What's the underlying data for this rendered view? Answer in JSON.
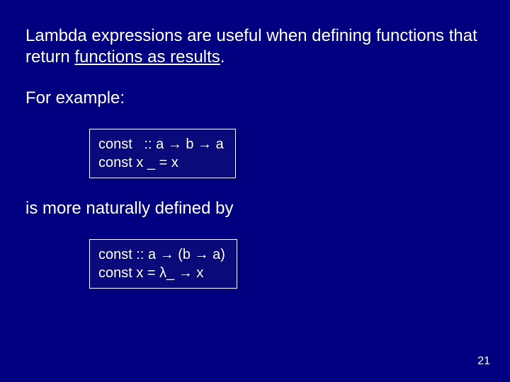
{
  "heading": {
    "part1": "Lambda expressions are useful when defining functions that return ",
    "underlined": "functions as results",
    "part3": "."
  },
  "for_example": "For example:",
  "code1": {
    "line1": "const   :: a → b → a",
    "line2": "const x _ = x"
  },
  "mid_text": "is more naturally defined by",
  "code2": {
    "line1": "const :: a → (b → a)",
    "line2": "const x = λ_ → x"
  },
  "page_number": "21"
}
